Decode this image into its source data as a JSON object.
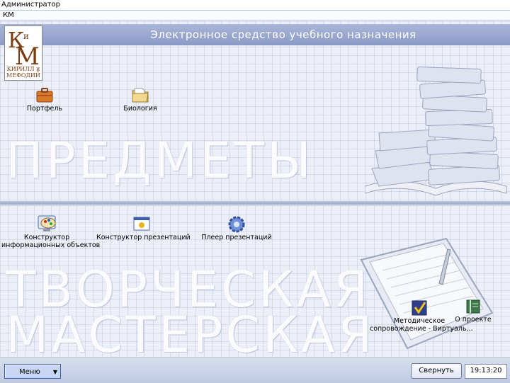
{
  "window": {
    "title": "Администратор"
  },
  "path": {
    "text": "КМ"
  },
  "header": {
    "title": "Электронное средство учебного назначения"
  },
  "logo": {
    "caption_line1": "КИРИЛЛ и",
    "caption_line2": "МЕФОДИЙ",
    "letters": "КиМ"
  },
  "sections": {
    "subjects": {
      "watermark": "ПРЕДМЕТЫ",
      "items": [
        {
          "label": "Портфель",
          "icon": "briefcase-icon"
        },
        {
          "label": "Биология",
          "icon": "folder-icon"
        }
      ]
    },
    "workshop": {
      "watermark_line1": "ТВОРЧЕСКАЯ",
      "watermark_line2": "МАСТЕРСКАЯ",
      "items": [
        {
          "label_line1": "Конструктор",
          "label_line2": "информационных объектов",
          "icon": "palette-monitor-icon"
        },
        {
          "label": "Конструктор презентаций",
          "icon": "presentation-window-icon"
        },
        {
          "label": "Плеер презентаций",
          "icon": "gear-icon"
        }
      ],
      "extra_items": [
        {
          "label_line1": "Методическое",
          "label_line2": "сопровождение - Виртуаль...",
          "icon": "checkmark-icon"
        },
        {
          "label": "О проекте",
          "icon": "book-icon"
        }
      ]
    }
  },
  "taskbar": {
    "menu_label": "Меню",
    "collapse_label": "Свернуть",
    "clock": "19:13:20"
  },
  "colors": {
    "header_strip": "#8c9bc6",
    "panel_bg": "#eceff7",
    "accent": "#3a5fa8"
  }
}
